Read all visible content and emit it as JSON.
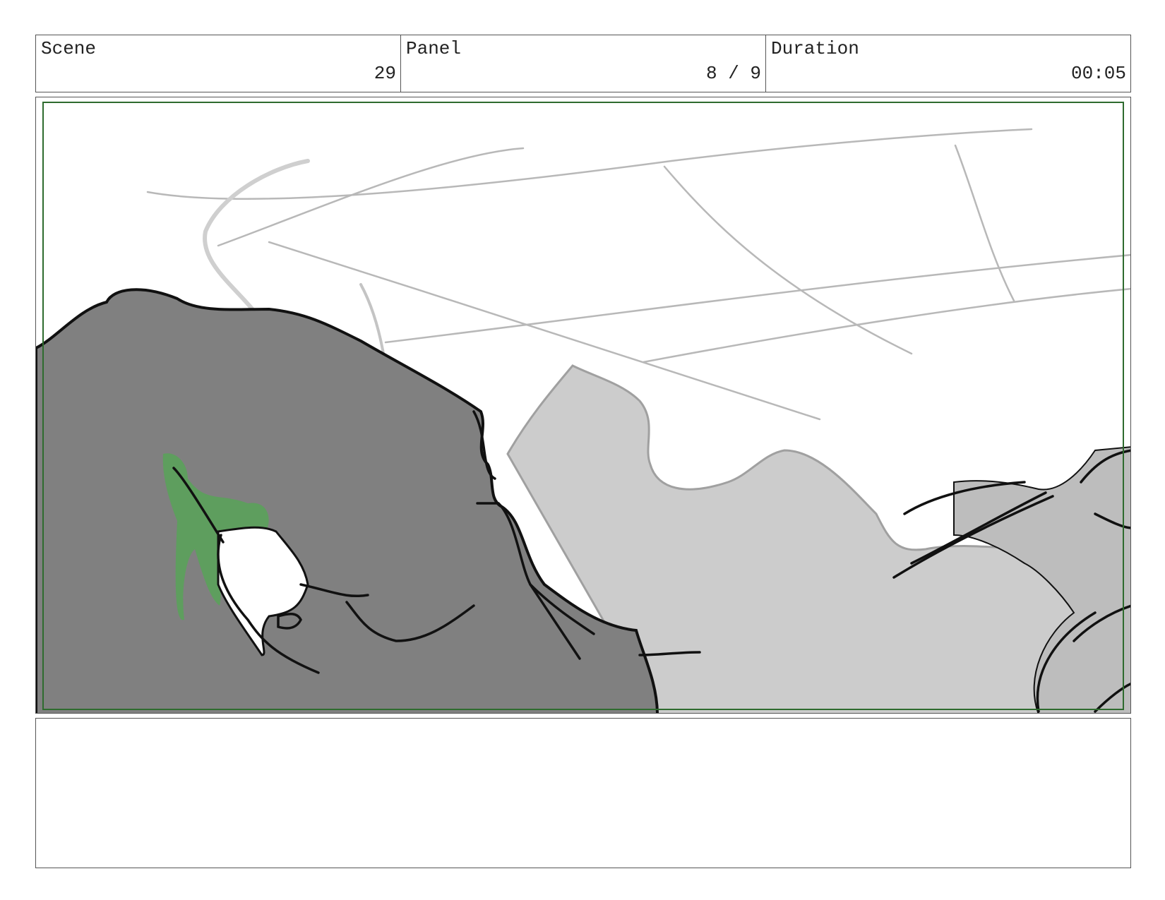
{
  "header": {
    "scene": {
      "label": "Scene",
      "value": "29"
    },
    "panel": {
      "label": "Panel",
      "value": "8 / 9"
    },
    "duration": {
      "label": "Duration",
      "value": "00:05"
    }
  },
  "notes": {
    "text": ""
  },
  "colors": {
    "frame_border": "#2e6b2e",
    "rock_dark": "#808080",
    "rock_light": "#cccccc",
    "foliage": "#5e9e5e",
    "ink": "#111111",
    "sketch": "#b5b5b5"
  }
}
